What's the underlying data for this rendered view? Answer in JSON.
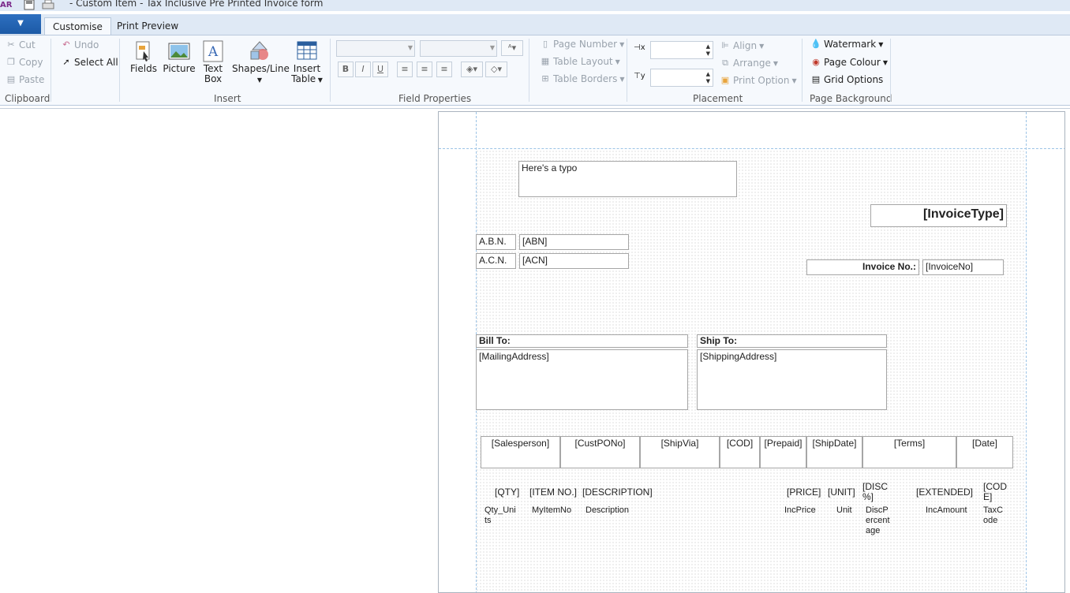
{
  "window": {
    "app_badge": "AR",
    "title": "- Custom Item - Tax Inclusive Pre Printed Invoice  form"
  },
  "tabs": [
    {
      "label": "Customise",
      "active": true
    },
    {
      "label": "Print Preview",
      "active": false
    }
  ],
  "ribbon": {
    "clipboard": {
      "cut": "Cut",
      "copy": "Copy",
      "paste": "Paste",
      "group": "Clipboard"
    },
    "edit": {
      "undo": "Undo",
      "select_all": "Select All"
    },
    "insert": {
      "fields": "Fields",
      "picture": "Picture",
      "text": "Text",
      "box": "Box",
      "shapes": "Shapes/Line",
      "insert": "Insert",
      "table": "Table",
      "group": "Insert"
    },
    "field_properties": {
      "group": "Field Properties",
      "bold": "B",
      "italic": "I",
      "underline": "U"
    },
    "table": {
      "page_number": "Page Number",
      "table_layout": "Table Layout",
      "table_borders": "Table Borders"
    },
    "placement": {
      "align": "Align",
      "arrange": "Arrange",
      "print_option": "Print Option",
      "group": "Placement"
    },
    "page_background": {
      "watermark": "Watermark",
      "page_colour": "Page Colour",
      "grid_options": "Grid Options",
      "group": "Page Background"
    }
  },
  "form": {
    "typo_box": "Here's a typo",
    "invoice_type": "[InvoiceType]",
    "abn_label": "A.B.N.",
    "abn_value": "[ABN]",
    "acn_label": "A.C.N.",
    "acn_value": "[ACN]",
    "invoice_no_label": "Invoice No.:",
    "invoice_no_value": "[InvoiceNo]",
    "bill_to": "Bill To:",
    "mailing_address": "[MailingAddress]",
    "ship_to": "Ship To:",
    "shipping_address": "[ShippingAddress]",
    "info_row": [
      "[Salesperson]",
      "[CustPONo]",
      "[ShipVia]",
      "[COD]",
      "[Prepaid]",
      "[ShipDate]",
      "[Terms]",
      "[Date]"
    ],
    "line_headers": {
      "qty": "[QTY]",
      "item_no": "[ITEM NO.]",
      "description": "[DESCRIPTION]",
      "price": "[PRICE]",
      "unit": "[UNIT]",
      "disc_1": "[DISC",
      "disc_2": "%]",
      "extended": "[EXTENDED]",
      "code_1": "[COD",
      "code_2": "E]"
    },
    "line_fields": {
      "qty_1": "Qty_Uni",
      "qty_2": "ts",
      "item_no": "MyItemNo",
      "description": "Description",
      "price": "IncPrice",
      "unit": "Unit",
      "disc_1": "DiscP",
      "disc_2": "ercent",
      "disc_3": "age",
      "amount": "IncAmount",
      "tax_1": "TaxC",
      "tax_2": "ode"
    }
  }
}
